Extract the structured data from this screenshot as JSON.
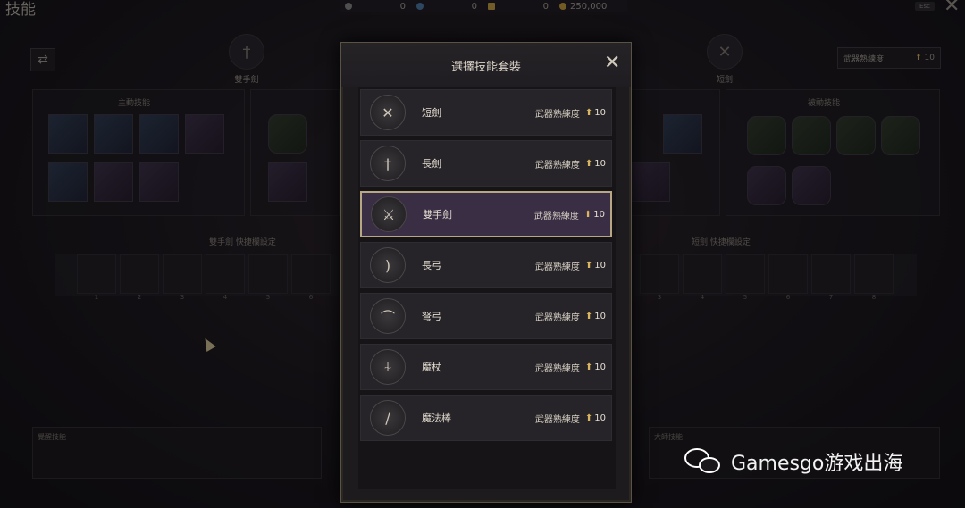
{
  "header": {
    "title": "技能",
    "currencies": [
      {
        "icon": "gray-gem-icon",
        "value": "0",
        "color": "#8a8a8a"
      },
      {
        "icon": "blue-gem-icon",
        "value": "0",
        "color": "#4a7da8"
      },
      {
        "icon": "gold-ticket-icon",
        "value": "0",
        "color": "#c9a442"
      },
      {
        "icon": "gold-coin-icon",
        "value": "250,000",
        "color": "#c9a13a"
      }
    ],
    "esc_label": "Esc"
  },
  "background": {
    "left_weapon": "雙手劍",
    "right_weapon": "短劍",
    "active_skills_title": "主動技能",
    "passive_skills_title": "被動技能",
    "left_bar_title": "雙手劍 快捷欄設定",
    "right_bar_title": "短劍 快捷欄設定",
    "slot_numbers": [
      "1",
      "2",
      "3",
      "4",
      "5",
      "6"
    ],
    "right_slot_numbers": [
      "3",
      "4",
      "5",
      "6",
      "7",
      "8"
    ],
    "mastery_label": "武器熟練度",
    "mastery_value": "10",
    "bottom_left_title": "覺醒技能",
    "bottom_right_title": "大師技能"
  },
  "modal": {
    "title": "選擇技能套裝",
    "items": [
      {
        "name": "短劍",
        "icon": "crossed-daggers-icon",
        "mastery_label": "武器熟練度",
        "value": "10",
        "selected": false
      },
      {
        "name": "長劍",
        "icon": "longsword-icon",
        "mastery_label": "武器熟練度",
        "value": "10",
        "selected": false
      },
      {
        "name": "雙手劍",
        "icon": "greatsword-icon",
        "mastery_label": "武器熟練度",
        "value": "10",
        "selected": true
      },
      {
        "name": "長弓",
        "icon": "longbow-icon",
        "mastery_label": "武器熟練度",
        "value": "10",
        "selected": false
      },
      {
        "name": "弩弓",
        "icon": "crossbow-icon",
        "mastery_label": "武器熟練度",
        "value": "10",
        "selected": false
      },
      {
        "name": "魔杖",
        "icon": "staff-icon",
        "mastery_label": "武器熟練度",
        "value": "10",
        "selected": false
      },
      {
        "name": "魔法棒",
        "icon": "wand-icon",
        "mastery_label": "武器熟練度",
        "value": "10",
        "selected": false
      }
    ]
  },
  "watermark": {
    "text": "Gamesgo游戏出海"
  }
}
